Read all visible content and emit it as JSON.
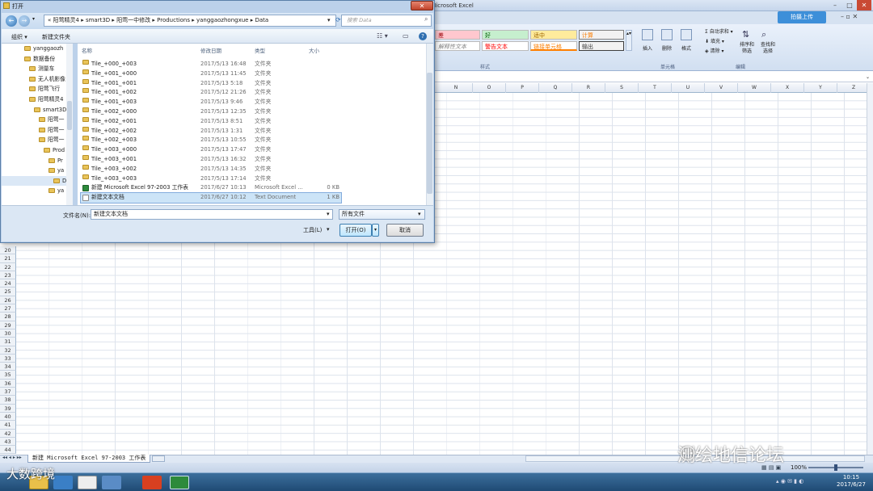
{
  "excel": {
    "title": "新建 Microsoft Excel 97-2003 工作表 - Microsoft Excel",
    "title_visible": "03 工作表 - Microsoft Excel",
    "title_prefix": "新建",
    "upload_label": "拍摄上传",
    "styles": {
      "bad": "差",
      "good": "好",
      "neutral": "适中",
      "calc": "计算",
      "explain": "解释性文本",
      "warn": "警告文本",
      "linked": "链接单元格",
      "output": "输出"
    },
    "group_styles": "样式",
    "cells": {
      "insert": "插入",
      "delete": "删除",
      "format": "格式",
      "group": "单元格"
    },
    "editing": {
      "autosum": "自动求和",
      "fill": "填充",
      "clear": "清除",
      "sort": "排序和\n筛选",
      "find": "查找和\n选择",
      "group": "编辑"
    },
    "columns": [
      "N",
      "O",
      "P",
      "Q",
      "R",
      "S",
      "T",
      "U",
      "V",
      "W",
      "X",
      "Y",
      "Z"
    ],
    "rows": [
      "20",
      "21",
      "22",
      "23",
      "24",
      "25",
      "26",
      "27",
      "28",
      "29",
      "30",
      "31",
      "32",
      "33",
      "34",
      "35",
      "36",
      "37",
      "38",
      "39",
      "40",
      "41",
      "42",
      "43",
      "44"
    ],
    "sheet_tab": "新建 Microsoft Excel 97-2003 工作表",
    "zoom": "100%"
  },
  "dialog": {
    "title": "打开",
    "breadcrumb": [
      "阳莺精灵4",
      "smart3D",
      "阳莺一中修改",
      "Productions",
      "yanggaozhongxue",
      "Data"
    ],
    "search_placeholder": "搜索 Data",
    "organize": "组织 ▾",
    "new_folder": "新建文件夹",
    "tree": [
      "yanggaozh",
      "数据备份",
      "测量车",
      "无人机影像",
      "阳莺飞行",
      "阳莺精灵4",
      "smart3D",
      "阳莺一",
      "阳莺一",
      "阳莺一",
      "Prod",
      "Pr",
      "ya",
      "D",
      "ya"
    ],
    "headers": {
      "name": "名称",
      "date": "修改日期",
      "type": "类型",
      "size": "大小"
    },
    "files": [
      {
        "name": "Tile_+000_+003",
        "date": "2017/5/13 16:48",
        "type": "文件夹",
        "size": "",
        "kind": "folder"
      },
      {
        "name": "Tile_+001_+000",
        "date": "2017/5/13 11:45",
        "type": "文件夹",
        "size": "",
        "kind": "folder"
      },
      {
        "name": "Tile_+001_+001",
        "date": "2017/5/13 5:18",
        "type": "文件夹",
        "size": "",
        "kind": "folder"
      },
      {
        "name": "Tile_+001_+002",
        "date": "2017/5/12 21:26",
        "type": "文件夹",
        "size": "",
        "kind": "folder"
      },
      {
        "name": "Tile_+001_+003",
        "date": "2017/5/13 9:46",
        "type": "文件夹",
        "size": "",
        "kind": "folder"
      },
      {
        "name": "Tile_+002_+000",
        "date": "2017/5/13 12:35",
        "type": "文件夹",
        "size": "",
        "kind": "folder"
      },
      {
        "name": "Tile_+002_+001",
        "date": "2017/5/13 8:51",
        "type": "文件夹",
        "size": "",
        "kind": "folder"
      },
      {
        "name": "Tile_+002_+002",
        "date": "2017/5/13 1:31",
        "type": "文件夹",
        "size": "",
        "kind": "folder"
      },
      {
        "name": "Tile_+002_+003",
        "date": "2017/5/13 10:55",
        "type": "文件夹",
        "size": "",
        "kind": "folder"
      },
      {
        "name": "Tile_+003_+000",
        "date": "2017/5/13 17:47",
        "type": "文件夹",
        "size": "",
        "kind": "folder"
      },
      {
        "name": "Tile_+003_+001",
        "date": "2017/5/13 16:32",
        "type": "文件夹",
        "size": "",
        "kind": "folder"
      },
      {
        "name": "Tile_+003_+002",
        "date": "2017/5/13 14:35",
        "type": "文件夹",
        "size": "",
        "kind": "folder"
      },
      {
        "name": "Tile_+003_+003",
        "date": "2017/5/13 17:14",
        "type": "文件夹",
        "size": "",
        "kind": "folder"
      },
      {
        "name": "新建 Microsoft Excel 97-2003 工作表",
        "date": "2017/6/27 10:13",
        "type": "Microsoft Excel ...",
        "size": "0 KB",
        "kind": "excel"
      },
      {
        "name": "新建文本文档",
        "date": "2017/6/27 10:12",
        "type": "Text Document",
        "size": "1 KB",
        "kind": "text"
      }
    ],
    "filename_label": "文件名(N):",
    "filename_value": "新建文本文档",
    "filetype_value": "所有文件",
    "tools_label": "工具(L)",
    "open_label": "打开(O)",
    "cancel_label": "取消"
  },
  "taskbar": {
    "clock_time": "10:15",
    "clock_date": "2017/6/27"
  },
  "watermarks": {
    "right": "测绘地信论坛",
    "left": "大数跨境"
  }
}
